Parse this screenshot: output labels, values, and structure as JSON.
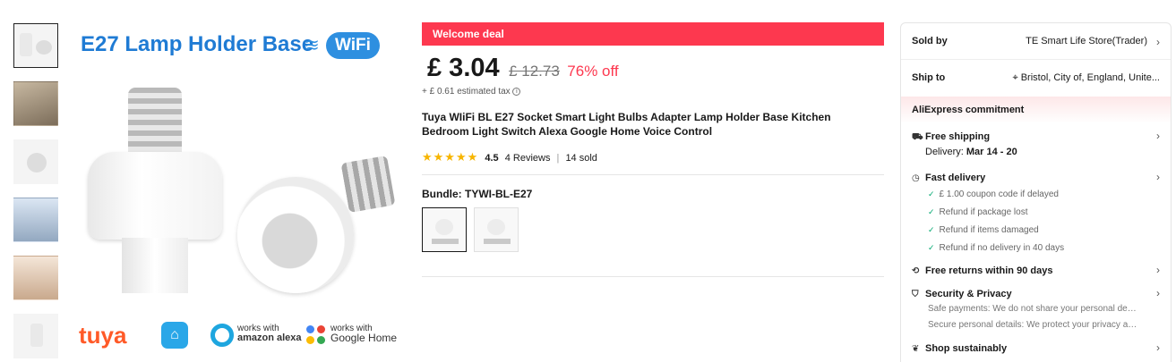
{
  "gallery": {
    "main_title": "E27 Lamp Holder Base",
    "wifi_badge": "WiFi",
    "logos": {
      "tuya": "tuya",
      "alexa_line1": "works with",
      "alexa_line2": "amazon alexa",
      "google_line1": "works with",
      "google_line2": "Google Home"
    }
  },
  "deal": {
    "label": "Welcome deal",
    "price": "£ 3.04",
    "old_price": "£ 12.73",
    "discount": "76% off",
    "tax": "+ £ 0.61 estimated tax",
    "tax_icon": "ⓘ"
  },
  "product": {
    "title": "Tuya WIiFi BL E27 Socket Smart Light Bulbs Adapter Lamp Holder Base Kitchen Bedroom Light Switch Alexa Google Home Voice Control",
    "stars": "★★★★★",
    "rating": "4.5",
    "reviews": "4 Reviews",
    "sep": "|",
    "sold": "14 sold",
    "rating_value": 4.5
  },
  "bundle": {
    "label": "Bundle: TYWI-BL-E27"
  },
  "panel": {
    "sold_by_label": "Sold by",
    "sold_by_value": "TE Smart Life Store(Trader)",
    "ship_to_label": "Ship to",
    "ship_to_value": "Bristol, City of, England, Unite...",
    "commitment": "AliExpress commitment",
    "free_shipping": "Free shipping",
    "delivery_label": "Delivery:",
    "delivery_dates": "Mar 14 - 20",
    "fast_delivery": "Fast delivery",
    "fast_items": [
      "£ 1.00 coupon code if delayed",
      "Refund if package lost",
      "Refund if items damaged",
      "Refund if no delivery in 40 days"
    ],
    "free_returns": "Free returns within 90 days",
    "security": "Security & Privacy",
    "security_items": [
      "Safe payments: We do not share your personal detail...",
      "Secure personal details: We protect your privacy and ..."
    ],
    "sustain": "Shop sustainably",
    "chevron": "›"
  },
  "colors": {
    "deal_red": "#fd384f",
    "brand_blue": "#1f7bd4",
    "star": "#f7b500",
    "check_green": "#00a870"
  }
}
